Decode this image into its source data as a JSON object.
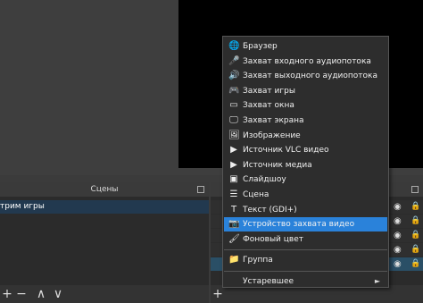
{
  "scenes": {
    "title": "Сцены",
    "items": [
      "трим игры"
    ],
    "toolbar": [
      "+",
      "−",
      "∧",
      "∨"
    ]
  },
  "sources": {
    "toolbar": [
      "+"
    ]
  },
  "context_menu": {
    "items": [
      {
        "label": "Браузер",
        "icon": "globe-icon",
        "glyph": "🌐"
      },
      {
        "label": "Захват входного аудиопотока",
        "icon": "microphone-icon",
        "glyph": "🎤"
      },
      {
        "label": "Захват выходного аудиопотока",
        "icon": "speaker-icon",
        "glyph": "🔊"
      },
      {
        "label": "Захват игры",
        "icon": "gamepad-icon",
        "glyph": "🎮"
      },
      {
        "label": "Захват окна",
        "icon": "window-icon",
        "glyph": "▭"
      },
      {
        "label": "Захват экрана",
        "icon": "monitor-icon",
        "glyph": "🖵"
      },
      {
        "label": "Изображение",
        "icon": "image-icon",
        "glyph": "🖼"
      },
      {
        "label": "Источник VLC видео",
        "icon": "play-icon",
        "glyph": "▶"
      },
      {
        "label": "Источник медиа",
        "icon": "play-icon",
        "glyph": "▶"
      },
      {
        "label": "Слайдшоу",
        "icon": "slideshow-icon",
        "glyph": "▣"
      },
      {
        "label": "Сцена",
        "icon": "list-icon",
        "glyph": "☰"
      },
      {
        "label": "Текст (GDI+)",
        "icon": "text-icon",
        "glyph": "T"
      },
      {
        "label": "Устройство захвата видео",
        "icon": "camera-icon",
        "glyph": "📷"
      },
      {
        "label": "Фоновый цвет",
        "icon": "brush-icon",
        "glyph": "🖌"
      },
      {
        "label": "Группа",
        "icon": "folder-icon",
        "glyph": "📁"
      },
      {
        "label": "Устаревшее",
        "icon": "",
        "glyph": ""
      }
    ],
    "active_index": 12,
    "submenu_arrow": "►"
  },
  "colors": {
    "highlight": "#2a82da",
    "menu_bg": "#2d2d2d",
    "scene_selected": "#22394f"
  }
}
